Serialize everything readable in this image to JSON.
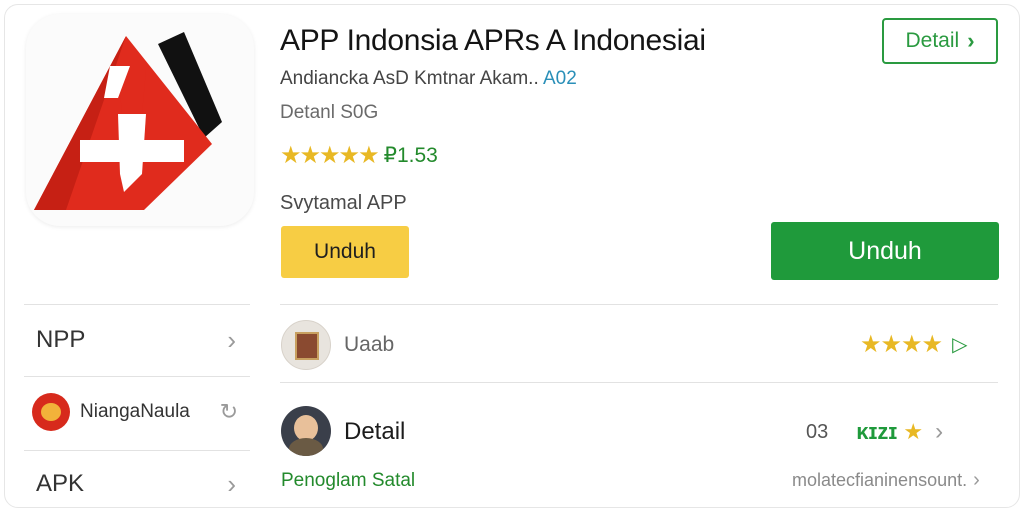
{
  "app": {
    "title": "APP Indonsia APRs A Indonesiai",
    "developer": "Andiancka AsD Kmtnar Akam..",
    "version": "A02",
    "size": "Detanl S0G",
    "stars": "★★★★★",
    "rating": "₽1.53",
    "category": "Svytamal APP"
  },
  "buttons": {
    "detail_label": "Detail",
    "detail_chevron": "›",
    "download_secondary": "Unduh",
    "download_primary": "Unduh"
  },
  "left_list": [
    {
      "label": "NPP",
      "icon": "chevron-right-icon",
      "glyph": "›"
    },
    {
      "label": "NiangaNaula",
      "icon": "refresh-icon",
      "glyph": "↻"
    },
    {
      "label": "APK",
      "icon": "chevron-right-icon",
      "glyph": "›"
    }
  ],
  "rows": [
    {
      "label": "Uaab",
      "stars": "★★★★",
      "trail": "▷"
    },
    {
      "label": "Detail",
      "count": "03",
      "mixed": "ᴋɪzɪ",
      "star": "★",
      "trail": "›"
    }
  ],
  "footer": {
    "link": "Penoglam Satal",
    "note": "molatecfianinensount.",
    "trail": "›"
  },
  "colors": {
    "primary_green": "#1f9a3b",
    "accent_yellow": "#f7cd44",
    "star_yellow": "#e8b824",
    "link_green": "#238a2c"
  }
}
